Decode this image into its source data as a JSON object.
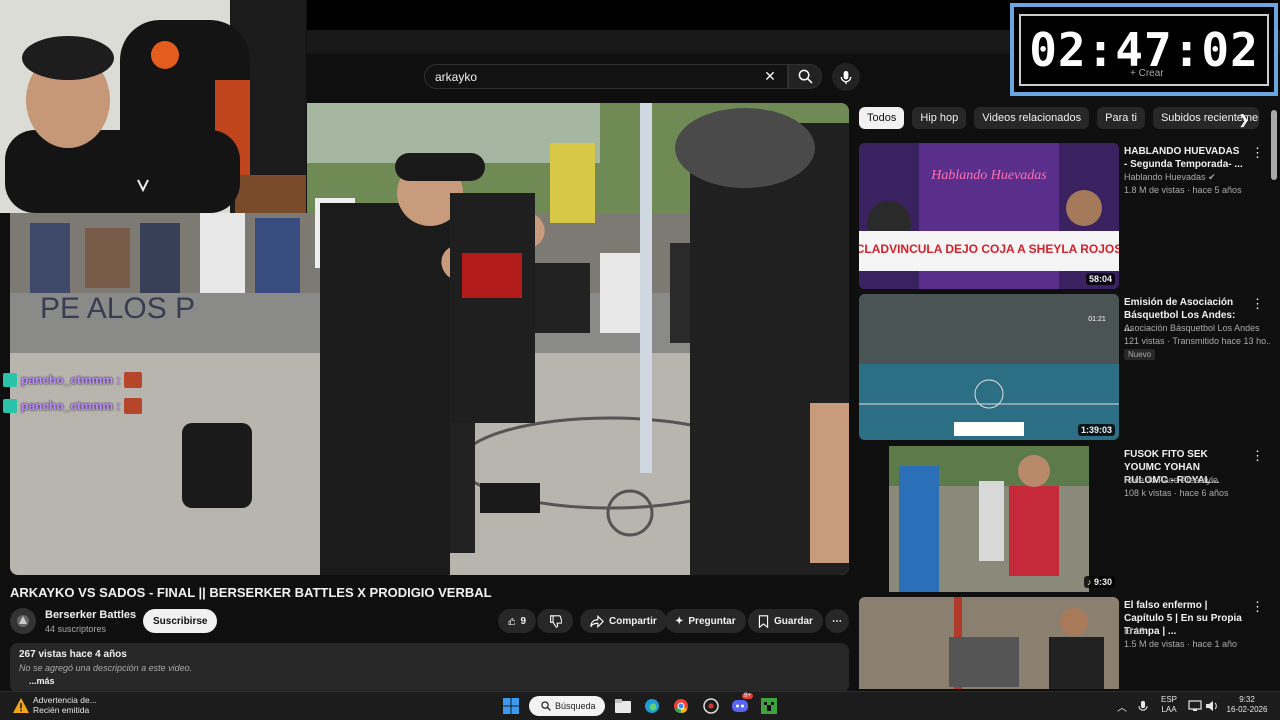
{
  "search": {
    "value": "arkayko"
  },
  "overlay": {
    "timer": "02:47:02",
    "crear_label": "Crear",
    "notif_count": "9+"
  },
  "chat": [
    {
      "user": "pancho_ctmmm :"
    },
    {
      "user": "pancho_ctmmm :"
    }
  ],
  "chips": [
    {
      "label": "Todos",
      "active": true
    },
    {
      "label": "Hip hop"
    },
    {
      "label": "Videos relacionados"
    },
    {
      "label": "Para ti"
    },
    {
      "label": "Subidos recientemente"
    }
  ],
  "recommendations": [
    {
      "title": "HABLANDO HUEVADAS - Segunda Temporada- ...",
      "channel": "Hablando Huevadas",
      "meta": "1.8 M de vistas · hace 5 años",
      "duration": "58:04",
      "thumb_text_top": "Hablando Huevadas",
      "thumb_caption": "CLADVINCULA DEJO COJA A SHEYLA ROJOS"
    },
    {
      "title": "Emisión de Asociación Básquetbol Los Andes: ...",
      "channel": "Asociación Básquetbol Los Andes",
      "meta": "121 vistas · Transmitido hace 13 ho...",
      "badge": "Nuevo",
      "duration": "1:39:03",
      "thumb_score": "01:21"
    },
    {
      "title": "FUSOK  FITO SEK  YOUMC YOHAN  RULOMC - ROYAL...",
      "channel": "Face To Face Freestyle",
      "meta": "108 k vistas · hace 6 años",
      "duration": "9:30"
    },
    {
      "title": "El falso enfermo | Capítulo 5 | En su Propia Trampa | ...",
      "channel": "El 13",
      "meta": "1.5 M de vistas · hace 1 año"
    }
  ],
  "video": {
    "title": "ARKAYKO VS SADOS - FINAL || BERSERKER BATTLES X PRODIGIO VERBAL",
    "channel": "Berserker Battles",
    "subscribers": "44 suscriptores",
    "subscribe_label": "Suscribirse",
    "likes": "9",
    "share_label": "Compartir",
    "ask_label": "Preguntar",
    "save_label": "Guardar",
    "views_date": "267 vistas  hace 4 años",
    "description": "No se agregó una descripción a este video.",
    "more_label": "...más",
    "scene_wall_text": "PE    ALOS P"
  },
  "taskbar": {
    "warning_title": "Advertencia de...",
    "warning_sub": "Recién emitida",
    "search_label": "Búsqueda",
    "discord_badge": "9+",
    "lang_top": "ESP",
    "lang_bottom": "LAA",
    "time": "9:32",
    "date": "16-02-2026"
  },
  "colors": {
    "accent": "#6aa7e0",
    "chat_name": "#b98cff",
    "bg": "#0f0f0f"
  }
}
